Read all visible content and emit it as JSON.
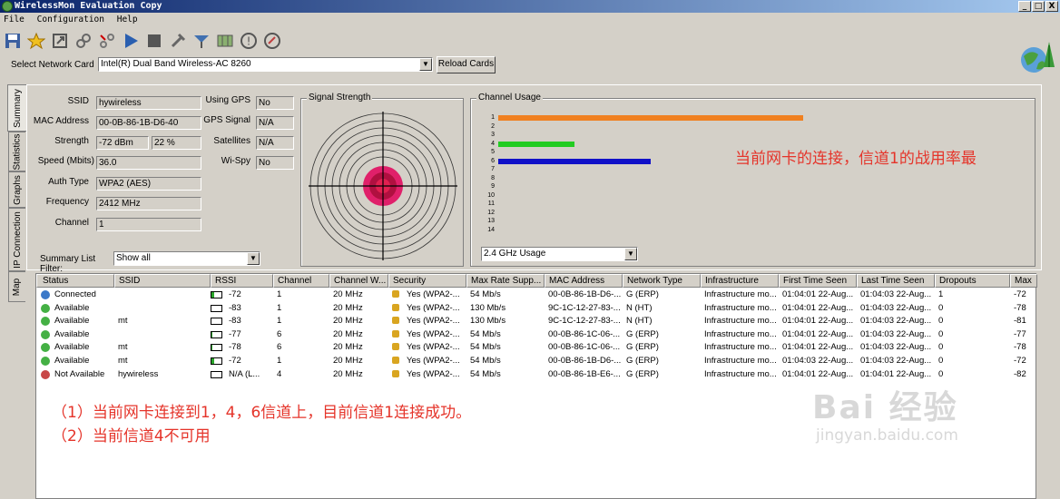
{
  "window": {
    "title": "WirelessMon Evaluation Copy",
    "min": "_",
    "max": "□",
    "close": "X"
  },
  "menu": [
    "File",
    "Configuration",
    "Help"
  ],
  "toolbar": [
    "save-icon",
    "star-icon",
    "export-icon",
    "link-icon",
    "connect-icon",
    "play-icon",
    "stop-icon",
    "tools-icon",
    "antenna-icon",
    "map-icon",
    "help-icon",
    "update-icon"
  ],
  "network_card": {
    "label": "Select Network Card",
    "value": "Intel(R) Dual Band Wireless-AC 8260",
    "reload": "Reload Cards"
  },
  "tabs": [
    "Summary",
    "Statistics",
    "Graphs",
    "IP Connection",
    "Map"
  ],
  "summary": {
    "ssid": {
      "label": "SSID",
      "value": "hywireless"
    },
    "mac": {
      "label": "MAC Address",
      "value": "00-0B-86-1B-D6-40"
    },
    "strength": {
      "label": "Strength",
      "value": "-72 dBm",
      "pct": "22 %"
    },
    "speed": {
      "label": "Speed (Mbits)",
      "value": "36.0"
    },
    "auth": {
      "label": "Auth Type",
      "value": "WPA2 (AES)"
    },
    "freq": {
      "label": "Frequency",
      "value": "2412 MHz"
    },
    "channel": {
      "label": "Channel",
      "value": "1"
    },
    "gps": {
      "label": "Using GPS",
      "value": "No"
    },
    "gps_signal": {
      "label": "GPS Signal",
      "value": "N/A"
    },
    "satellites": {
      "label": "Satellites",
      "value": "N/A"
    },
    "wispy": {
      "label": "Wi-Spy",
      "value": "No"
    },
    "filter": {
      "label": "Summary List Filter:",
      "value": "Show all"
    }
  },
  "signal_strength": {
    "title": "Signal Strength"
  },
  "channel_usage": {
    "title": "Channel Usage",
    "band": "2.4 GHz Usage",
    "channels": [
      "1",
      "2",
      "3",
      "4",
      "5",
      "6",
      "7",
      "8",
      "9",
      "10",
      "11",
      "12",
      "13",
      "14"
    ],
    "bars": [
      {
        "channel": 1,
        "value": 4,
        "color": "#f08020"
      },
      {
        "channel": 4,
        "value": 1,
        "color": "#22cc22"
      },
      {
        "channel": 6,
        "value": 2,
        "color": "#1010c8"
      }
    ],
    "max": 4
  },
  "annotation_top": "当前网卡的连接，信道1的战用率最",
  "table": {
    "headers": [
      "Status",
      "SSID",
      "RSSI",
      "Channel",
      "Channel W...",
      "Security",
      "Max Rate Supp...",
      "MAC Address",
      "Network Type",
      "Infrastructure",
      "First Time Seen",
      "Last Time Seen",
      "Dropouts",
      "Max"
    ],
    "rows": [
      {
        "status": "Connected",
        "color": "#3a78c8",
        "ssid": "",
        "sig": 0.3,
        "rssi": "-72",
        "ch": "1",
        "cw": "20 MHz",
        "sec": "Yes (WPA2-...",
        "rate": "54 Mb/s",
        "mac": "00-0B-86-1B-D6-...",
        "type": "G (ERP)",
        "infra": "Infrastructure mo...",
        "first": "01:04:01 22-Aug...",
        "last": "01:04:03 22-Aug...",
        "drop": "1",
        "max": "-72"
      },
      {
        "status": "Available",
        "color": "#44b044",
        "ssid": "",
        "sig": 0,
        "rssi": "-83",
        "ch": "1",
        "cw": "20 MHz",
        "sec": "Yes (WPA2-...",
        "rate": "130 Mb/s",
        "mac": "9C-1C-12-27-83-...",
        "type": "N (HT)",
        "infra": "Infrastructure mo...",
        "first": "01:04:01 22-Aug...",
        "last": "01:04:03 22-Aug...",
        "drop": "0",
        "max": "-78"
      },
      {
        "status": "Available",
        "color": "#44b044",
        "ssid": "mt",
        "sig": 0,
        "rssi": "-83",
        "ch": "1",
        "cw": "20 MHz",
        "sec": "Yes (WPA2-...",
        "rate": "130 Mb/s",
        "mac": "9C-1C-12-27-83-...",
        "type": "N (HT)",
        "infra": "Infrastructure mo...",
        "first": "01:04:01 22-Aug...",
        "last": "01:04:03 22-Aug...",
        "drop": "0",
        "max": "-81"
      },
      {
        "status": "Available",
        "color": "#44b044",
        "ssid": "",
        "sig": 0.1,
        "rssi": "-77",
        "ch": "6",
        "cw": "20 MHz",
        "sec": "Yes (WPA2-...",
        "rate": "54 Mb/s",
        "mac": "00-0B-86-1C-06-...",
        "type": "G (ERP)",
        "infra": "Infrastructure mo...",
        "first": "01:04:01 22-Aug...",
        "last": "01:04:03 22-Aug...",
        "drop": "0",
        "max": "-77"
      },
      {
        "status": "Available",
        "color": "#44b044",
        "ssid": "mt",
        "sig": 0.1,
        "rssi": "-78",
        "ch": "6",
        "cw": "20 MHz",
        "sec": "Yes (WPA2-...",
        "rate": "54 Mb/s",
        "mac": "00-0B-86-1C-06-...",
        "type": "G (ERP)",
        "infra": "Infrastructure mo...",
        "first": "01:04:01 22-Aug...",
        "last": "01:04:03 22-Aug...",
        "drop": "0",
        "max": "-78"
      },
      {
        "status": "Available",
        "color": "#44b044",
        "ssid": "mt",
        "sig": 0.3,
        "rssi": "-72",
        "ch": "1",
        "cw": "20 MHz",
        "sec": "Yes (WPA2-...",
        "rate": "54 Mb/s",
        "mac": "00-0B-86-1B-D6-...",
        "type": "G (ERP)",
        "infra": "Infrastructure mo...",
        "first": "01:04:03 22-Aug...",
        "last": "01:04:03 22-Aug...",
        "drop": "0",
        "max": "-72"
      },
      {
        "status": "Not Available",
        "color": "#c84848",
        "ssid": "hywireless",
        "sig": 0,
        "rssi": "N/A (L...",
        "ch": "4",
        "cw": "20 MHz",
        "sec": "Yes (WPA2-...",
        "rate": "54 Mb/s",
        "mac": "00-0B-86-1B-E6-...",
        "type": "G (ERP)",
        "infra": "Infrastructure mo...",
        "first": "01:04:01 22-Aug...",
        "last": "01:04:01 22-Aug...",
        "drop": "0",
        "max": "-82"
      }
    ]
  },
  "annotation_bottom": [
    "（1）当前网卡连接到1，4，6信道上，目前信道1连接成功。",
    "（2）当前信道4不可用"
  ],
  "watermark": {
    "brand": "Bai 经验",
    "url": "jingyan.baidu.com"
  }
}
